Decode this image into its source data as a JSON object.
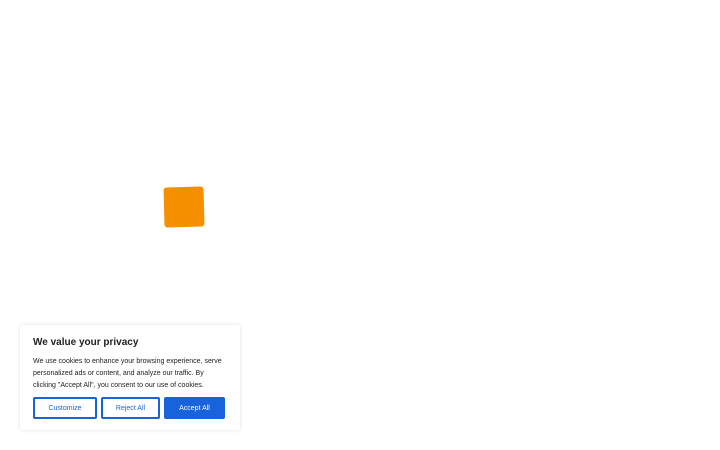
{
  "loader": {
    "color": "#f58f00"
  },
  "cookie_banner": {
    "title": "We value your privacy",
    "text": "We use cookies to enhance your browsing experience, serve personalized ads or content, and analyze our traffic. By clicking \"Accept All\", you consent to our use of cookies.",
    "buttons": {
      "customize": "Customize",
      "reject_all": "Reject All",
      "accept_all": "Accept All"
    },
    "accent_color": "#1863dc"
  }
}
